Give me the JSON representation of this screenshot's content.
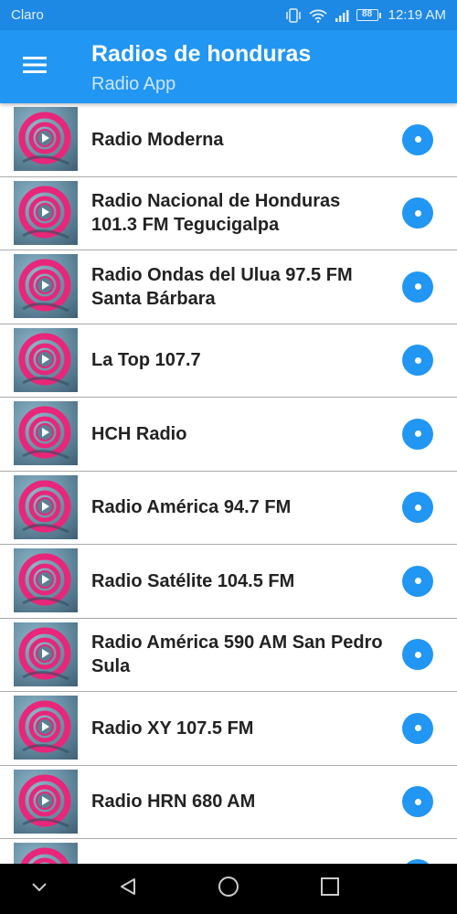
{
  "status_bar": {
    "carrier": "Claro",
    "battery": "88",
    "time": "12:19 AM"
  },
  "app_bar": {
    "title": "Radios de honduras",
    "subtitle": "Radio App"
  },
  "stations": [
    {
      "name": "Radio Moderna"
    },
    {
      "name": "Radio Nacional de Honduras 101.3 FM Tegucigalpa"
    },
    {
      "name": "Radio Ondas del Ulua 97.5 FM Santa Bárbara"
    },
    {
      "name": "La Top 107.7"
    },
    {
      "name": "HCH Radio"
    },
    {
      "name": "Radio América 94.7 FM"
    },
    {
      "name": "Radio Satélite 104.5 FM"
    },
    {
      "name": "Radio América 590 AM San Pedro Sula"
    },
    {
      "name": "Radio XY 107.5 FM"
    },
    {
      "name": "Radio HRN 680 AM"
    }
  ],
  "colors": {
    "status_bar": "#1e88e5",
    "app_bar": "#2196f3",
    "play_button": "#2196f3",
    "logo_pink": "#e8267a"
  },
  "icons": {
    "menu": "hamburger-menu-icon",
    "play": "play-dot-icon",
    "nav_back": "back-triangle-icon",
    "nav_home": "home-circle-icon",
    "nav_recent": "recent-square-icon",
    "nav_hide": "chevron-down-icon"
  }
}
